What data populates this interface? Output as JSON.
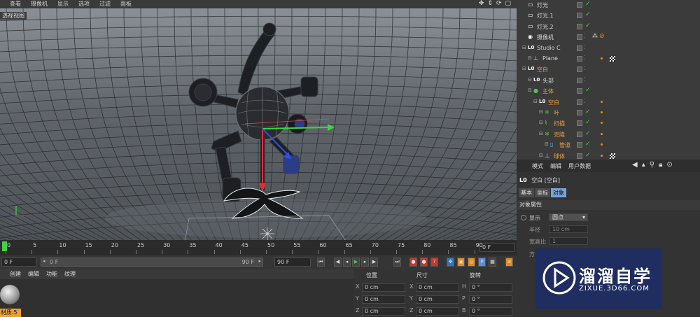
{
  "menubar": {
    "items": [
      "查看",
      "摄像机",
      "显示",
      "选项",
      "过滤",
      "面板"
    ]
  },
  "viewport": {
    "label": "透视视图"
  },
  "object_manager": {
    "rows": [
      {
        "name": "灯光",
        "color": "white",
        "depth": 0,
        "icon": "light-icon",
        "check": true
      },
      {
        "name": "灯光.1",
        "color": "white",
        "depth": 0,
        "icon": "light-icon",
        "check": true
      },
      {
        "name": "灯光.2",
        "color": "white",
        "depth": 0,
        "icon": "light-icon",
        "check": true
      },
      {
        "name": "摄像机",
        "color": "white",
        "depth": 0,
        "icon": "camera-icon",
        "check": false
      },
      {
        "name": "Studio C",
        "color": "white",
        "depth": 0,
        "icon": "null-icon",
        "check": false
      },
      {
        "name": "Plane",
        "color": "white",
        "depth": 1,
        "icon": "plane-icon",
        "check": false
      },
      {
        "name": "空白",
        "color": "orange",
        "depth": 0,
        "icon": "null-icon",
        "check": false
      },
      {
        "name": "头部",
        "color": "white",
        "depth": 1,
        "icon": "null-icon",
        "check": false
      },
      {
        "name": "主体",
        "color": "orange",
        "depth": 1,
        "icon": "sphere-icon",
        "check": true
      },
      {
        "name": "空白",
        "color": "orange",
        "depth": 2,
        "icon": "null-icon",
        "check": false
      },
      {
        "name": "叶",
        "color": "orange",
        "depth": 3,
        "icon": "cloner-icon",
        "check": true
      },
      {
        "name": "扫描",
        "color": "orange",
        "depth": 3,
        "icon": "sweep-icon",
        "check": true
      },
      {
        "name": "克隆",
        "color": "orange",
        "depth": 3,
        "icon": "cloner-icon",
        "check": true
      },
      {
        "name": "管道",
        "color": "orange",
        "depth": 4,
        "icon": "tube-icon",
        "check": true
      },
      {
        "name": "球体",
        "color": "orange",
        "depth": 3,
        "icon": "sphere-primitive-icon",
        "check": true
      }
    ]
  },
  "attribute_manager": {
    "menu": [
      "模式",
      "编辑",
      "用户数据"
    ],
    "object_title": "空白 [空白]",
    "tabs": [
      "基本",
      "坐标",
      "对象"
    ],
    "active_tab": "对象",
    "section": "对象属性",
    "display_label": "显示",
    "display_value": "圆点",
    "radius_label": "半径",
    "radius_value": "10 cm",
    "aspect_label": "宽高比",
    "aspect_value": "1",
    "orientation_label": "方"
  },
  "timeline": {
    "ticks": [
      "0",
      "5",
      "10",
      "15",
      "20",
      "25",
      "30",
      "35",
      "40",
      "45",
      "50",
      "55",
      "60",
      "65",
      "70",
      "75",
      "80",
      "85",
      "90"
    ],
    "current_frame": "0 F"
  },
  "transport": {
    "start_frame": "0 F",
    "range_start": "0 F",
    "range_end": "90 F",
    "end_frame": "90 F"
  },
  "material_manager": {
    "menu": [
      "创建",
      "编辑",
      "功能",
      "纹理"
    ],
    "material_name": "材质.5"
  },
  "coordinates": {
    "headers": [
      "位置",
      "尺寸",
      "旋转"
    ],
    "rows": [
      {
        "axis": "X",
        "pos": "0 cm",
        "size": "0 cm",
        "rot_axis": "H",
        "rot": "0 °"
      },
      {
        "axis": "Y",
        "pos": "0 cm",
        "size": "0 cm",
        "rot_axis": "P",
        "rot": "0 °"
      },
      {
        "axis": "Z",
        "pos": "0 cm",
        "size": "0 cm",
        "rot_axis": "B",
        "rot": "0 °"
      }
    ]
  },
  "watermark": {
    "brand": "溜溜自学",
    "url": "ZIXUE.3D66.COM"
  },
  "colors": {
    "accent_orange": "#e9a13b",
    "check_green": "#4fc94f",
    "tab_active": "#76a4d4",
    "watermark_bg": "#1e2d64"
  }
}
